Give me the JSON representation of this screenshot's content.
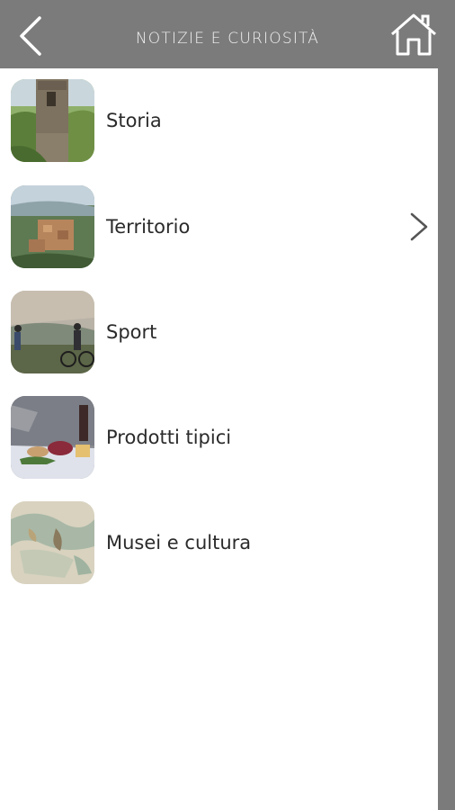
{
  "header": {
    "title": "NOTIZIE E CURIOSITÀ",
    "back_icon": "chevron-left-icon",
    "home_icon": "home-icon",
    "bar_color": "#7b7b7b"
  },
  "items": [
    {
      "label": "Storia",
      "thumb": "tower-photo"
    },
    {
      "label": "Territorio",
      "thumb": "village-aerial-photo",
      "selected_chevron": "chevron-right-icon"
    },
    {
      "label": "Sport",
      "thumb": "cyclists-photo"
    },
    {
      "label": "Prodotti tipici",
      "thumb": "food-table-photo"
    },
    {
      "label": "Musei e cultura",
      "thumb": "fresco-photo"
    }
  ]
}
